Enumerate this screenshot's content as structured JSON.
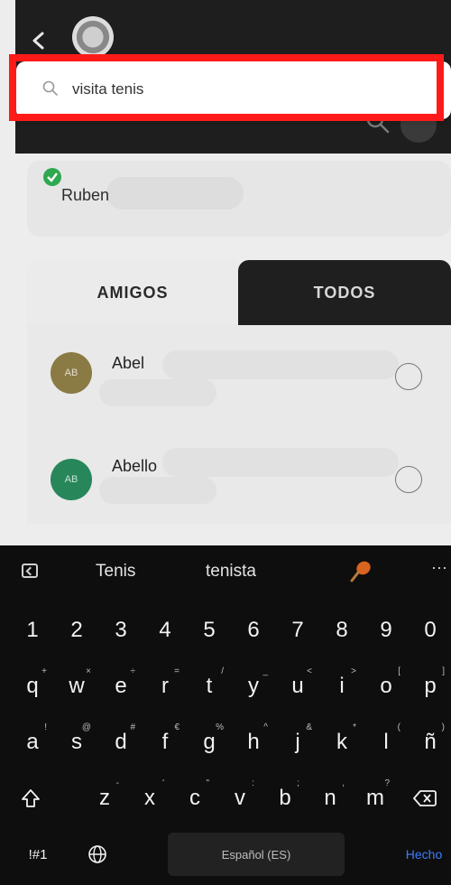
{
  "header": {
    "back_icon": "chevron-left-icon",
    "logo_icon": "club-crest-icon"
  },
  "search": {
    "value": "visita tenis",
    "icon": "search-icon"
  },
  "selected_user": {
    "name": "Ruben",
    "status_icon": "check-circle-icon",
    "status_color": "#2fa84f"
  },
  "tabs": [
    {
      "label": "AMIGOS",
      "active": true
    },
    {
      "label": "TODOS",
      "active": false
    }
  ],
  "friends": [
    {
      "initials": "AB",
      "name": "Abel",
      "avatar_color": "#8a7a44"
    },
    {
      "initials": "AB",
      "name": "Abello",
      "avatar_color": "#27875a"
    }
  ],
  "keyboard": {
    "suggestions": [
      "Tenis",
      "tenista"
    ],
    "more_label": "···",
    "numbers": [
      "1",
      "2",
      "3",
      "4",
      "5",
      "6",
      "7",
      "8",
      "9",
      "0"
    ],
    "row1": [
      {
        "k": "q",
        "s": "+"
      },
      {
        "k": "w",
        "s": "×"
      },
      {
        "k": "e",
        "s": "÷"
      },
      {
        "k": "r",
        "s": "="
      },
      {
        "k": "t",
        "s": "/"
      },
      {
        "k": "y",
        "s": "_"
      },
      {
        "k": "u",
        "s": "<"
      },
      {
        "k": "i",
        "s": ">"
      },
      {
        "k": "o",
        "s": "["
      },
      {
        "k": "p",
        "s": "]"
      }
    ],
    "row2": [
      {
        "k": "a",
        "s": "!"
      },
      {
        "k": "s",
        "s": "@"
      },
      {
        "k": "d",
        "s": "#"
      },
      {
        "k": "f",
        "s": "€"
      },
      {
        "k": "g",
        "s": "%"
      },
      {
        "k": "h",
        "s": "^"
      },
      {
        "k": "j",
        "s": "&"
      },
      {
        "k": "k",
        "s": "*"
      },
      {
        "k": "l",
        "s": "("
      },
      {
        "k": "ñ",
        "s": ")"
      }
    ],
    "row3": [
      {
        "k": "z",
        "s": "-"
      },
      {
        "k": "x",
        "s": "'"
      },
      {
        "k": "c",
        "s": "\""
      },
      {
        "k": "v",
        "s": ":"
      },
      {
        "k": "b",
        "s": ";"
      },
      {
        "k": "n",
        "s": ","
      },
      {
        "k": "m",
        "s": "?"
      }
    ],
    "symbols_label": "!#1",
    "space_label": "Español (ES)",
    "done_label": "Hecho"
  }
}
